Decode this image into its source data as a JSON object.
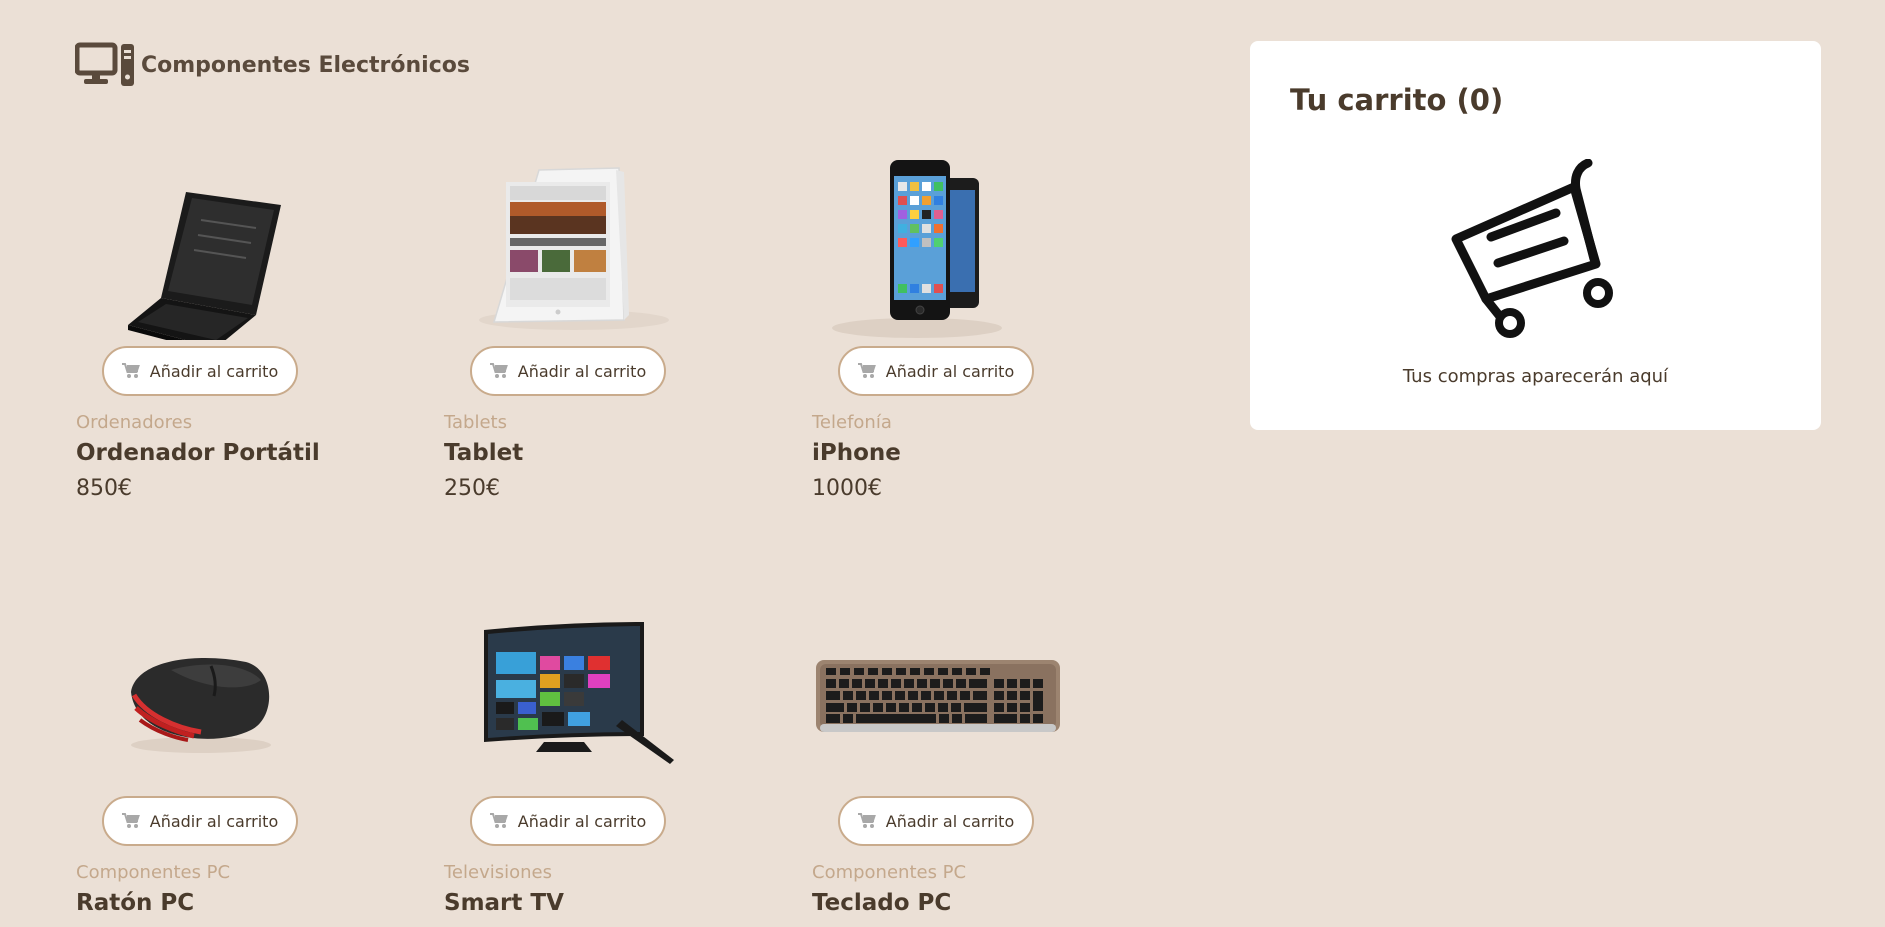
{
  "header": {
    "title": "Componentes Electrónicos",
    "icon": "computer-icon"
  },
  "products": [
    {
      "image": "laptop-image",
      "add_label": "Añadir al carrito",
      "category": "Ordenadores",
      "name": "Ordenador Portátil",
      "price": "850€"
    },
    {
      "image": "tablet-image",
      "add_label": "Añadir al carrito",
      "category": "Tablets",
      "name": "Tablet",
      "price": "250€"
    },
    {
      "image": "iphone-image",
      "add_label": "Añadir al carrito",
      "category": "Telefonía",
      "name": "iPhone",
      "price": "1000€"
    },
    {
      "image": "mouse-image",
      "add_label": "Añadir al carrito",
      "category": "Componentes PC",
      "name": "Ratón PC",
      "price": ""
    },
    {
      "image": "smart-tv-image",
      "add_label": "Añadir al carrito",
      "category": "Televisiones",
      "name": "Smart TV",
      "price": ""
    },
    {
      "image": "keyboard-image",
      "add_label": "Añadir al carrito",
      "category": "Componentes PC",
      "name": "Teclado PC",
      "price": ""
    }
  ],
  "cart": {
    "title": "Tu carrito (0)",
    "empty_message": "Tus compras aparecerán aquí",
    "icon": "shopping-cart-icon"
  },
  "colors": {
    "background": "#ebe0d6",
    "accent": "#c4a88c",
    "text": "#4a3b2c",
    "button_border": "#c9ab8c"
  }
}
